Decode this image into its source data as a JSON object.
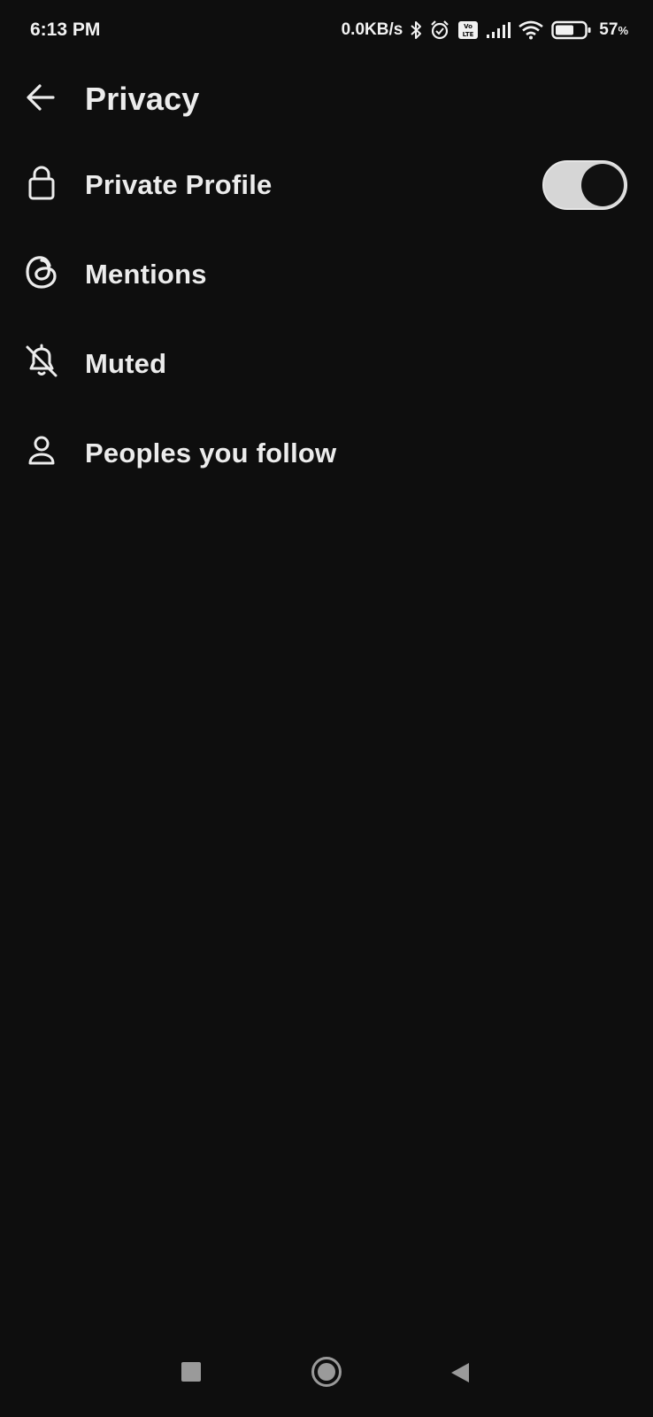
{
  "status_bar": {
    "time": "6:13 PM",
    "network_speed": "0.0KB/s",
    "battery_level": "57",
    "battery_unit": "%",
    "icons": [
      "bluetooth-icon",
      "alarm-icon",
      "volte-icon",
      "signal-icon",
      "wifi-icon",
      "battery-icon"
    ]
  },
  "header": {
    "title": "Privacy",
    "back_icon": "arrow-left-icon"
  },
  "menu": {
    "items": [
      {
        "label": "Private Profile",
        "icon": "lock-icon",
        "toggle": true,
        "toggle_on": true
      },
      {
        "label": "Mentions",
        "icon": "threads-at-icon"
      },
      {
        "label": "Muted",
        "icon": "bell-off-icon"
      },
      {
        "label": "Peoples you follow",
        "icon": "person-icon"
      }
    ]
  },
  "nav_bar": {
    "buttons": [
      "recents-button",
      "home-button",
      "back-button"
    ]
  },
  "colors": {
    "background": "#0e0e0e",
    "text": "#ececec",
    "toggle_track": "#d6d6d6",
    "toggle_knob": "#111111",
    "nav_icons": "#9a9a9a"
  }
}
